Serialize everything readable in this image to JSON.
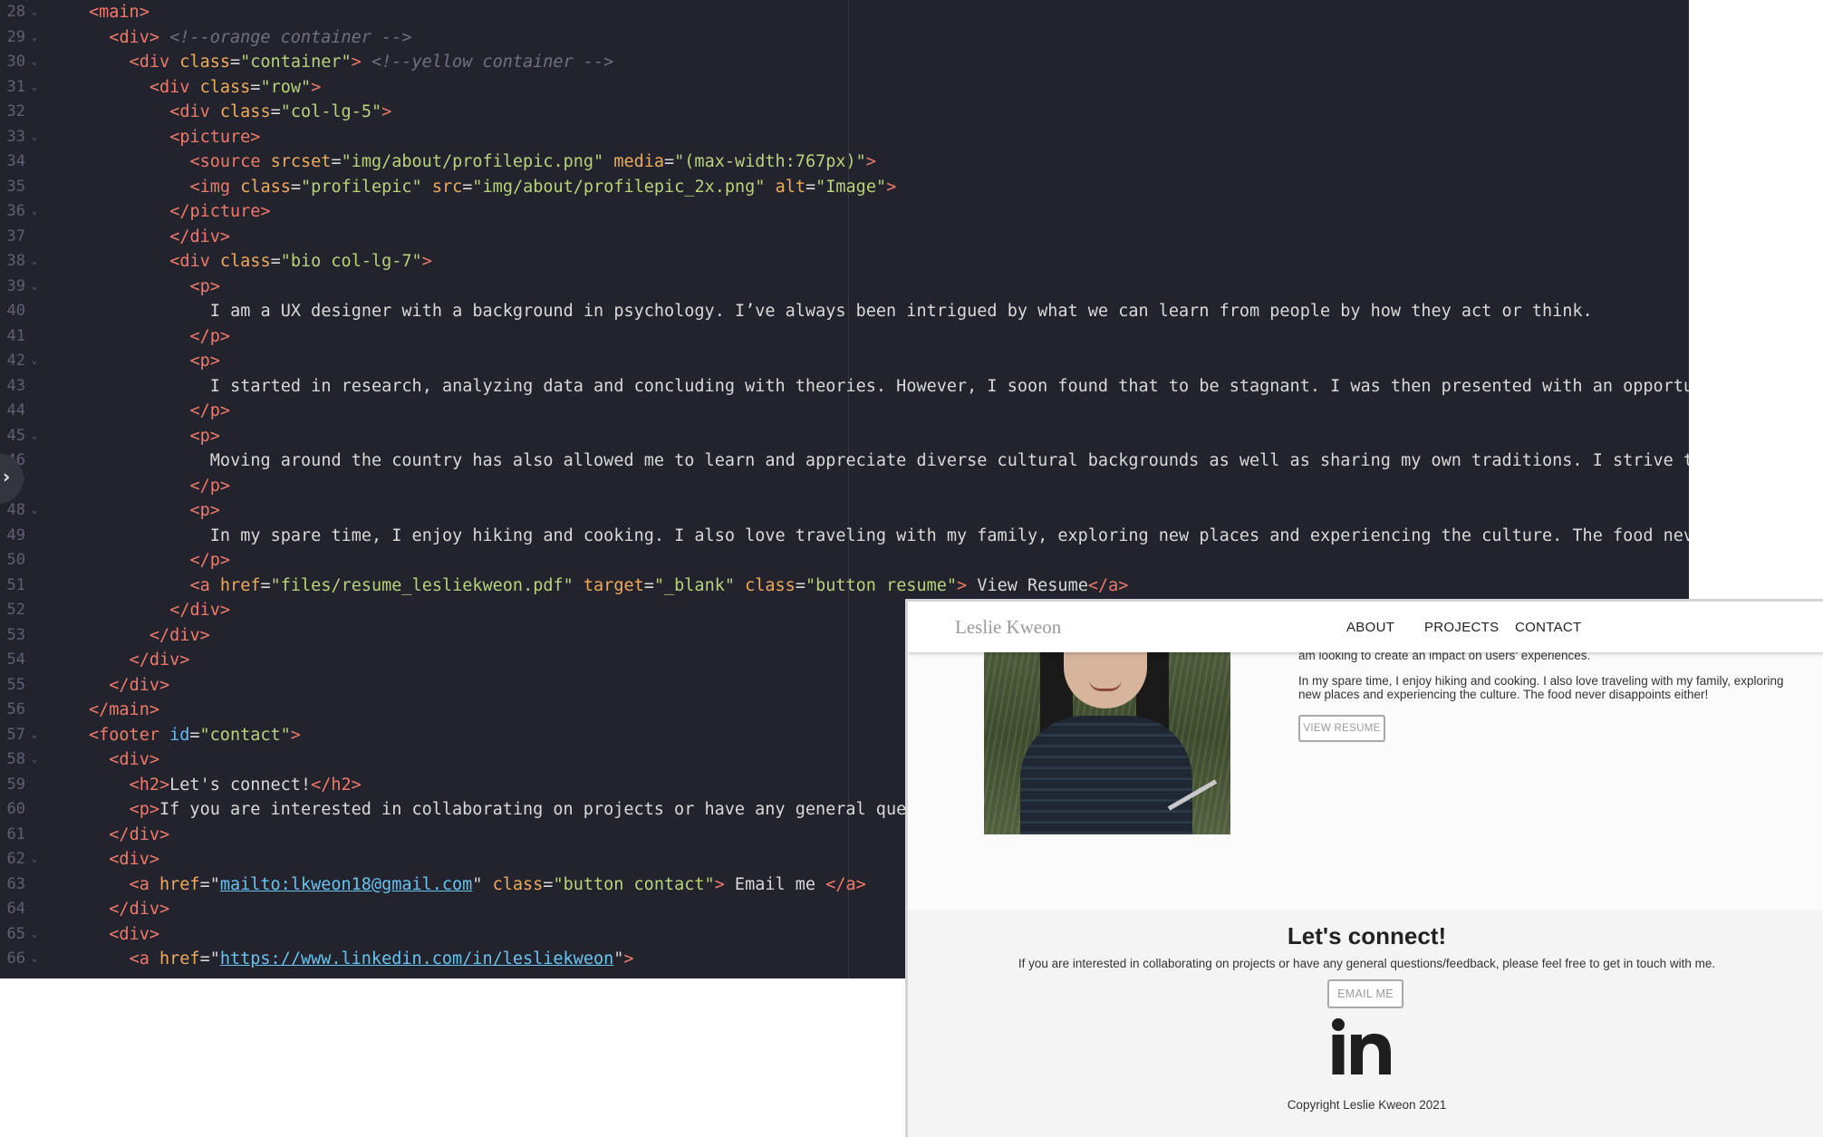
{
  "editor": {
    "lines": [
      {
        "n": "28",
        "fold": true,
        "indent": 0,
        "tokens": [
          [
            "tag",
            "<"
          ],
          [
            "tag",
            "main"
          ],
          [
            "tag",
            ">"
          ]
        ]
      },
      {
        "n": "29",
        "fold": true,
        "indent": 1,
        "tokens": [
          [
            "tag",
            "<"
          ],
          [
            "tag",
            "div"
          ],
          [
            "tag",
            ">"
          ],
          [
            "plain",
            " "
          ],
          [
            "cmt",
            "<!--orange container -->"
          ]
        ]
      },
      {
        "n": "30",
        "fold": true,
        "indent": 2,
        "tokens": [
          [
            "tag",
            "<div"
          ],
          [
            "plain",
            " "
          ],
          [
            "attr",
            "class"
          ],
          [
            "plain",
            "="
          ],
          [
            "str",
            "\"container\""
          ],
          [
            "tag",
            ">"
          ],
          [
            "plain",
            " "
          ],
          [
            "cmt",
            "<!--yellow container -->"
          ]
        ]
      },
      {
        "n": "31",
        "fold": true,
        "indent": 3,
        "tokens": [
          [
            "tag",
            "<div"
          ],
          [
            "plain",
            " "
          ],
          [
            "attr",
            "class"
          ],
          [
            "plain",
            "="
          ],
          [
            "str",
            "\"row\""
          ],
          [
            "tag",
            ">"
          ]
        ]
      },
      {
        "n": "32",
        "fold": false,
        "indent": 4,
        "tokens": [
          [
            "tag",
            "<div"
          ],
          [
            "plain",
            " "
          ],
          [
            "attr",
            "class"
          ],
          [
            "plain",
            "="
          ],
          [
            "str",
            "\"col-lg-5\""
          ],
          [
            "tag",
            ">"
          ]
        ]
      },
      {
        "n": "33",
        "fold": true,
        "indent": 4,
        "tokens": [
          [
            "tag",
            "<picture>"
          ]
        ]
      },
      {
        "n": "34",
        "fold": false,
        "indent": 5,
        "tokens": [
          [
            "tag",
            "<source"
          ],
          [
            "plain",
            " "
          ],
          [
            "attr",
            "srcset"
          ],
          [
            "plain",
            "="
          ],
          [
            "str",
            "\"img/about/profilepic.png\""
          ],
          [
            "plain",
            " "
          ],
          [
            "attr",
            "media"
          ],
          [
            "plain",
            "="
          ],
          [
            "str",
            "\"(max-width:767px)\""
          ],
          [
            "tag",
            ">"
          ]
        ]
      },
      {
        "n": "35",
        "fold": false,
        "indent": 5,
        "tokens": [
          [
            "tag",
            "<img"
          ],
          [
            "plain",
            " "
          ],
          [
            "attr",
            "class"
          ],
          [
            "plain",
            "="
          ],
          [
            "str",
            "\"profilepic\""
          ],
          [
            "plain",
            " "
          ],
          [
            "attr",
            "src"
          ],
          [
            "plain",
            "="
          ],
          [
            "str",
            "\"img/about/profilepic_2x.png\""
          ],
          [
            "plain",
            " "
          ],
          [
            "attr",
            "alt"
          ],
          [
            "plain",
            "="
          ],
          [
            "str",
            "\"Image\""
          ],
          [
            "tag",
            ">"
          ]
        ]
      },
      {
        "n": "36",
        "fold": true,
        "indent": 4,
        "tokens": [
          [
            "tag",
            "</picture>"
          ]
        ]
      },
      {
        "n": "37",
        "fold": false,
        "indent": 4,
        "tokens": [
          [
            "tag",
            "</div>"
          ]
        ]
      },
      {
        "n": "38",
        "fold": true,
        "indent": 4,
        "tokens": [
          [
            "tag",
            "<div"
          ],
          [
            "plain",
            " "
          ],
          [
            "attr",
            "class"
          ],
          [
            "plain",
            "="
          ],
          [
            "str",
            "\"bio col-lg-7\""
          ],
          [
            "tag",
            ">"
          ]
        ]
      },
      {
        "n": "39",
        "fold": true,
        "indent": 5,
        "tokens": [
          [
            "tag",
            "<p>"
          ]
        ]
      },
      {
        "n": "40",
        "fold": false,
        "indent": 6,
        "tokens": [
          [
            "plain",
            "I am a UX designer with a background in psychology. I’ve always been intrigued by what we can learn from people by how they act or think."
          ]
        ]
      },
      {
        "n": "41",
        "fold": false,
        "indent": 5,
        "tokens": [
          [
            "tag",
            "</p>"
          ]
        ]
      },
      {
        "n": "42",
        "fold": true,
        "indent": 5,
        "tokens": [
          [
            "tag",
            "<p>"
          ]
        ]
      },
      {
        "n": "43",
        "fold": false,
        "indent": 6,
        "tokens": [
          [
            "plain",
            "I started in research, analyzing data and concluding with theories. However, I soon found that to be stagnant. I was then presented with an opportun"
          ]
        ]
      },
      {
        "n": "44",
        "fold": false,
        "indent": 5,
        "tokens": [
          [
            "tag",
            "</p>"
          ]
        ]
      },
      {
        "n": "45",
        "fold": true,
        "indent": 5,
        "tokens": [
          [
            "tag",
            "<p>"
          ]
        ]
      },
      {
        "n": "46",
        "fold": false,
        "indent": 6,
        "tokens": [
          [
            "plain",
            "Moving around the country has also allowed me to learn and appreciate diverse cultural backgrounds as well as sharing my own traditions. I strive to"
          ]
        ]
      },
      {
        "n": "47",
        "fold": false,
        "indent": 5,
        "tokens": [
          [
            "tag",
            "</p>"
          ]
        ]
      },
      {
        "n": "48",
        "fold": true,
        "indent": 5,
        "tokens": [
          [
            "tag",
            "<p>"
          ]
        ]
      },
      {
        "n": "49",
        "fold": false,
        "indent": 6,
        "tokens": [
          [
            "plain",
            "In my spare time, I enjoy hiking and cooking. I also love traveling with my family, exploring new places and experiencing the culture. The food neve"
          ]
        ]
      },
      {
        "n": "50",
        "fold": false,
        "indent": 5,
        "tokens": [
          [
            "tag",
            "</p>"
          ]
        ]
      },
      {
        "n": "51",
        "fold": false,
        "indent": 5,
        "tokens": [
          [
            "tag",
            "<a"
          ],
          [
            "plain",
            " "
          ],
          [
            "attr",
            "href"
          ],
          [
            "plain",
            "="
          ],
          [
            "str",
            "\"files/resume_lesliekweon.pdf\""
          ],
          [
            "plain",
            " "
          ],
          [
            "attr",
            "target"
          ],
          [
            "plain",
            "="
          ],
          [
            "str",
            "\"_blank\""
          ],
          [
            "plain",
            " "
          ],
          [
            "attr",
            "class"
          ],
          [
            "plain",
            "="
          ],
          [
            "str",
            "\"button resume\""
          ],
          [
            "tag",
            ">"
          ],
          [
            "plain",
            " View Resume"
          ],
          [
            "tag",
            "</a>"
          ]
        ]
      },
      {
        "n": "52",
        "fold": false,
        "indent": 4,
        "tokens": [
          [
            "tag",
            "</div>"
          ]
        ]
      },
      {
        "n": "53",
        "fold": false,
        "indent": 3,
        "tokens": [
          [
            "tag",
            "</div>"
          ]
        ]
      },
      {
        "n": "54",
        "fold": false,
        "indent": 2,
        "tokens": [
          [
            "tag",
            "</div>"
          ]
        ]
      },
      {
        "n": "55",
        "fold": false,
        "indent": 1,
        "tokens": [
          [
            "tag",
            "</div>"
          ]
        ]
      },
      {
        "n": "56",
        "fold": false,
        "indent": 0,
        "tokens": [
          [
            "tag",
            "</main>"
          ]
        ]
      },
      {
        "n": "57",
        "fold": true,
        "indent": 0,
        "tokens": [
          [
            "tag",
            "<footer"
          ],
          [
            "plain",
            " "
          ],
          [
            "id",
            "id"
          ],
          [
            "plain",
            "="
          ],
          [
            "str",
            "\"contact\""
          ],
          [
            "tag",
            ">"
          ]
        ]
      },
      {
        "n": "58",
        "fold": true,
        "indent": 1,
        "tokens": [
          [
            "tag",
            "<div>"
          ]
        ]
      },
      {
        "n": "59",
        "fold": false,
        "indent": 2,
        "tokens": [
          [
            "tag",
            "<h2>"
          ],
          [
            "plain",
            "Let's connect!"
          ],
          [
            "tag",
            "</h2>"
          ]
        ]
      },
      {
        "n": "60",
        "fold": false,
        "indent": 2,
        "tokens": [
          [
            "tag",
            "<p>"
          ],
          [
            "plain",
            "If you are interested in collaborating on projects or have any general ques"
          ]
        ]
      },
      {
        "n": "61",
        "fold": false,
        "indent": 1,
        "tokens": [
          [
            "tag",
            "</div>"
          ]
        ]
      },
      {
        "n": "62",
        "fold": true,
        "indent": 1,
        "tokens": [
          [
            "tag",
            "<div>"
          ]
        ]
      },
      {
        "n": "63",
        "fold": false,
        "indent": 2,
        "tokens": [
          [
            "tag",
            "<a"
          ],
          [
            "plain",
            " "
          ],
          [
            "attr",
            "href"
          ],
          [
            "plain",
            "=\""
          ],
          [
            "url",
            "mailto:lkweon18@gmail.com"
          ],
          [
            "plain",
            "\" "
          ],
          [
            "attr",
            "class"
          ],
          [
            "plain",
            "="
          ],
          [
            "str",
            "\"button contact\""
          ],
          [
            "tag",
            ">"
          ],
          [
            "plain",
            " Email me "
          ],
          [
            "tag",
            "</a>"
          ]
        ]
      },
      {
        "n": "64",
        "fold": false,
        "indent": 1,
        "tokens": [
          [
            "tag",
            "</div>"
          ]
        ]
      },
      {
        "n": "65",
        "fold": true,
        "indent": 1,
        "tokens": [
          [
            "tag",
            "<div>"
          ]
        ]
      },
      {
        "n": "66",
        "fold": true,
        "indent": 2,
        "tokens": [
          [
            "tag",
            "<a"
          ],
          [
            "plain",
            " "
          ],
          [
            "attr",
            "href"
          ],
          [
            "plain",
            "=\""
          ],
          [
            "url",
            "https://www.linkedin.com/in/lesliekweon"
          ],
          [
            "plain",
            "\""
          ],
          [
            "tag",
            ">"
          ]
        ]
      }
    ]
  },
  "preview": {
    "brand": "Leslie Kweon",
    "nav": [
      {
        "label": "ABOUT"
      },
      {
        "label": "PROJECTS"
      },
      {
        "label": "CONTACT"
      }
    ],
    "bio_partial": "am looking to create an impact on users' experiences.",
    "bio_paragraph_4": "In my spare time, I enjoy hiking and cooking. I also love traveling with my family, exploring new places and experiencing the culture. The food never disappoints either!",
    "resume_button": "VIEW RESUME",
    "footer": {
      "heading": "Let's connect!",
      "text": "If you are interested in collaborating on projects or have any general questions/feedback, please feel free to get in touch with me.",
      "email_button": "EMAIL ME",
      "linkedin_logo_text": "in",
      "copyright": "Copyright Leslie Kweon 2021"
    }
  },
  "colors": {
    "editor_bg": "#22232c",
    "tag": "#f07a6a",
    "attribute": "#f0ab5a",
    "string": "#b9d37a",
    "url": "#68c3f0",
    "comment": "#6f7180"
  },
  "icons": [
    "chevron-down-icon",
    "chevron-right-icon",
    "linkedin-icon"
  ]
}
